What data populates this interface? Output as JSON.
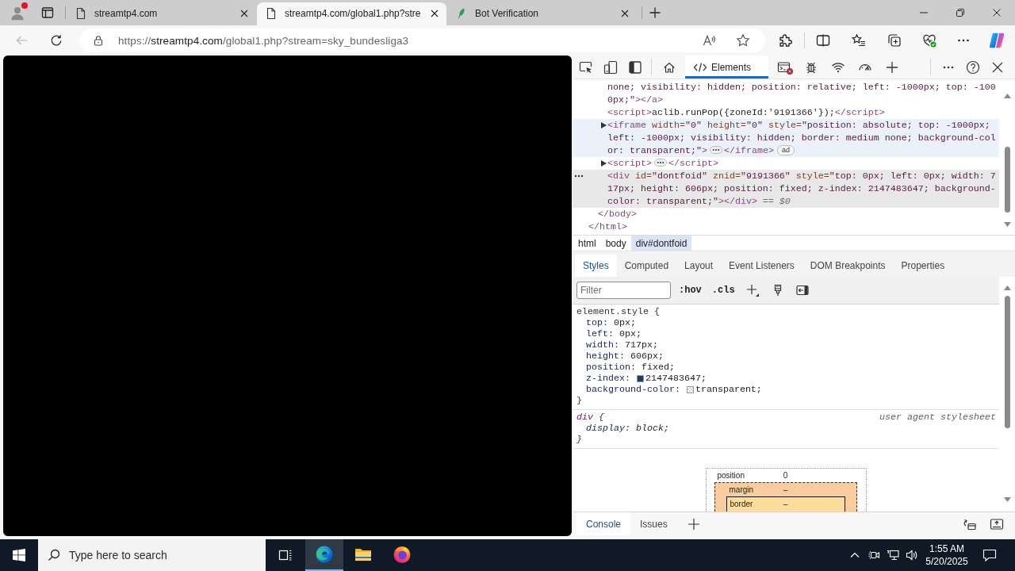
{
  "browser": {
    "profile": {
      "notification": true
    },
    "tabs": [
      {
        "title": "streamtp4.com",
        "kind": "page",
        "selected": false
      },
      {
        "title": "streamtp4.com/global1.php?stre",
        "kind": "page",
        "selected": true
      },
      {
        "title": "Bot Verification",
        "kind": "leaf",
        "selected": false
      }
    ],
    "navigation": {
      "back_enabled": false
    },
    "address": {
      "scheme": "https://",
      "host": "streamtp4.com",
      "path": "/global1.php?stream=sky_bundesliga3"
    }
  },
  "devtools": {
    "tools": [
      {
        "kind": "welcome",
        "selected": false
      },
      {
        "kind": "elements",
        "label": "Elements",
        "selected": true
      },
      {
        "kind": "console",
        "selected": false,
        "errors": true
      },
      {
        "kind": "sources",
        "selected": false
      },
      {
        "kind": "network",
        "selected": false
      },
      {
        "kind": "performance",
        "selected": false
      }
    ],
    "elements": {
      "nodes": [
        {
          "children": [
            {
              "children": [
                {
                  "expandable": false,
                  "selected": false,
                  "hovered": false,
                  "segments": [
                    {
                      "kind": "code",
                      "tokens": [
                        {
                          "kind": "value",
                          "text": "none; visibility: hidden; position: relative; left: -1000px; top: -1000px;\""
                        },
                        {
                          "kind": "tag",
                          "text": "></a>"
                        }
                      ]
                    }
                  ]
                },
                {
                  "expandable": false,
                  "selected": false,
                  "hovered": false,
                  "segments": [
                    {
                      "kind": "code",
                      "tokens": [
                        {
                          "kind": "tag",
                          "text": "<script>"
                        },
                        {
                          "kind": "text",
                          "text": "aclib.runPop({zoneId:'9191366'});"
                        },
                        {
                          "kind": "tag",
                          "text": "</script>"
                        }
                      ]
                    }
                  ]
                },
                {
                  "expandable": true,
                  "selected": false,
                  "hovered": true,
                  "segments": [
                    {
                      "kind": "code",
                      "tokens": [
                        {
                          "kind": "tag",
                          "text": "<iframe"
                        },
                        {
                          "kind": "attr",
                          "text": " width="
                        },
                        {
                          "kind": "value",
                          "text": "\"0\""
                        },
                        {
                          "kind": "attr",
                          "text": " height="
                        },
                        {
                          "kind": "value",
                          "text": "\"0\""
                        },
                        {
                          "kind": "attr",
                          "text": " style="
                        },
                        {
                          "kind": "value",
                          "text": "\"position: absolute; top: -1000px; left: -1000px; visibility: hidden; border: medium none; background-color: transparent;\""
                        },
                        {
                          "kind": "tag",
                          "text": ">"
                        }
                      ]
                    },
                    {
                      "kind": "ellipsis"
                    },
                    {
                      "kind": "code",
                      "tokens": [
                        {
                          "kind": "tag",
                          "text": "</iframe>"
                        }
                      ]
                    },
                    {
                      "kind": "badge",
                      "text": "ad"
                    }
                  ]
                },
                {
                  "expandable": true,
                  "selected": false,
                  "hovered": false,
                  "segments": [
                    {
                      "kind": "code",
                      "tokens": [
                        {
                          "kind": "tag",
                          "text": "<script>"
                        }
                      ]
                    },
                    {
                      "kind": "ellipsis"
                    },
                    {
                      "kind": "code",
                      "tokens": [
                        {
                          "kind": "tag",
                          "text": "</script>"
                        }
                      ]
                    }
                  ]
                },
                {
                  "expandable": false,
                  "selected": true,
                  "hovered": false,
                  "segments": [
                    {
                      "kind": "code",
                      "tokens": [
                        {
                          "kind": "tag",
                          "text": "<div"
                        },
                        {
                          "kind": "attr",
                          "text": " id="
                        },
                        {
                          "kind": "value",
                          "text": "\"dontfoid\""
                        },
                        {
                          "kind": "attr",
                          "text": " znid="
                        },
                        {
                          "kind": "value",
                          "text": "\"9191366\""
                        },
                        {
                          "kind": "attr",
                          "text": " style="
                        },
                        {
                          "kind": "value",
                          "text": "\"top: 0px; left: 0px; width: 717px; height: 606px; position: fixed; z-index: 2147483647; background-color: transparent;\""
                        },
                        {
                          "kind": "tag",
                          "text": "></div>"
                        },
                        {
                          "kind": "op",
                          "text": " == "
                        },
                        {
                          "kind": "ref",
                          "text": "$0"
                        }
                      ]
                    }
                  ]
                }
              ],
              "closing": [
                {
                  "kind": "tag",
                  "text": "</body>"
                }
              ]
            }
          ],
          "closing": [
            {
              "kind": "tag",
              "text": "</html>"
            }
          ]
        }
      ]
    },
    "breadcrumbs": [
      {
        "label": "html",
        "selected": false
      },
      {
        "label": "body",
        "selected": false
      },
      {
        "label": "div#dontfoid",
        "selected": true
      }
    ],
    "styles": {
      "tabs": [
        {
          "label": "Styles",
          "selected": true
        },
        {
          "label": "Computed",
          "selected": false
        },
        {
          "label": "Layout",
          "selected": false
        },
        {
          "label": "Event Listeners",
          "selected": false
        },
        {
          "label": "DOM Breakpoints",
          "selected": false
        },
        {
          "label": "Properties",
          "selected": false
        }
      ],
      "filter": {
        "placeholder": "Filter"
      },
      "toggles": [
        ":hov",
        ".cls"
      ],
      "rules": [
        {
          "selector": "element.style",
          "open": "{",
          "close": "}",
          "user_agent": false,
          "declarations": [
            {
              "property": "top:",
              "value": "0px;"
            },
            {
              "property": "left:",
              "value": "0px;"
            },
            {
              "property": "width:",
              "value": "717px;"
            },
            {
              "property": "height:",
              "value": "606px;"
            },
            {
              "property": "position:",
              "value": "fixed;"
            },
            {
              "property": "z-index:",
              "value": "2147483647;",
              "swatch": {
                "kind": "solid",
                "color": "#1c3f5f"
              }
            },
            {
              "property": "background-color:",
              "value": "transparent;",
              "swatch": {
                "kind": "checker"
              }
            }
          ]
        },
        {
          "selector": "div",
          "open": "{",
          "close": "}",
          "user_agent": true,
          "source": "user agent stylesheet",
          "declarations": [
            {
              "property": "display:",
              "value": "block;"
            }
          ]
        }
      ],
      "box_model": {
        "kind": "position",
        "label": "position",
        "value": "0",
        "children": [
          {
            "kind": "margin",
            "label": "margin",
            "value": "–",
            "children": [
              {
                "kind": "border",
                "label": "border",
                "value": "–"
              }
            ]
          }
        ]
      }
    },
    "drawer": {
      "tabs": [
        {
          "label": "Console",
          "selected": true
        },
        {
          "label": "Issues",
          "selected": false
        }
      ]
    }
  },
  "taskbar": {
    "search": {
      "placeholder": "Type here to search"
    },
    "apps": [
      {
        "kind": "edge",
        "active": true
      },
      {
        "kind": "explorer",
        "active": false
      },
      {
        "kind": "firefox",
        "active": false
      }
    ],
    "clock": {
      "time": "1:55 AM",
      "date": "5/20/2025"
    }
  }
}
